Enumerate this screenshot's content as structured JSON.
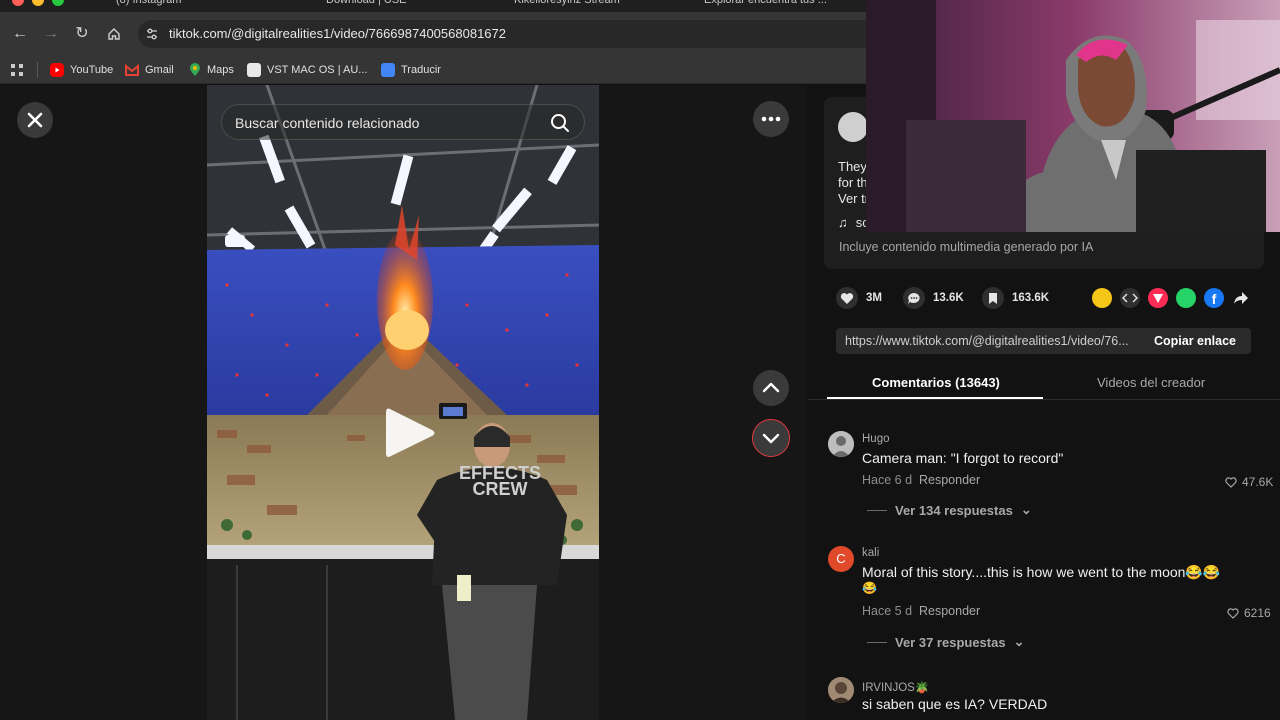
{
  "browser": {
    "tabs": [
      "(8) Instagram",
      "Download | USE",
      "Kikelloresylnz Stream",
      "Explorar encuentra tus ..."
    ],
    "url": "tiktok.com/@digitalrealities1/video/7666987400568081672",
    "bookmarks": [
      "YouTube",
      "Gmail",
      "Maps",
      "VST MAC OS | AU...",
      "Traducir"
    ]
  },
  "video": {
    "search_placeholder": "Buscar contenido relacionado",
    "shirt_text_line1": "EFFECTS",
    "shirt_text_line2": "CREW"
  },
  "description": {
    "line1": "They",
    "line2": "for th",
    "line3": "Ver tr",
    "sound": "sc",
    "ai_label": "Incluye contenido multimedia generado por IA"
  },
  "stats": {
    "likes": "3M",
    "comments": "13.6K",
    "saves": "163.6K"
  },
  "share": {
    "link": "https://www.tiktok.com/@digitalrealities1/video/76...",
    "copy_label": "Copiar enlace"
  },
  "tabs": {
    "comments": "Comentarios (13643)",
    "creator_videos": "Videos del creador"
  },
  "comments": [
    {
      "user": "Hugo",
      "text": "Camera man: \"I forgot to record\"",
      "time": "Hace 6 d",
      "reply": "Responder",
      "likes": "47.6K",
      "replies": "Ver 134 respuestas"
    },
    {
      "user": "kali",
      "avatar_letter": "C",
      "text": "Moral of this story....this is how we went to the moon😂😂",
      "text2": "😂",
      "time": "Hace 5 d",
      "reply": "Responder",
      "likes": "6216",
      "replies": "Ver 37 respuestas"
    },
    {
      "user": "IRVINJOS🪴",
      "text": "si saben que es IA? VERDAD"
    }
  ],
  "colors": {
    "accent_red": "#e0393c",
    "panel_bg": "#121212",
    "card_bg": "#1e1e1e"
  }
}
